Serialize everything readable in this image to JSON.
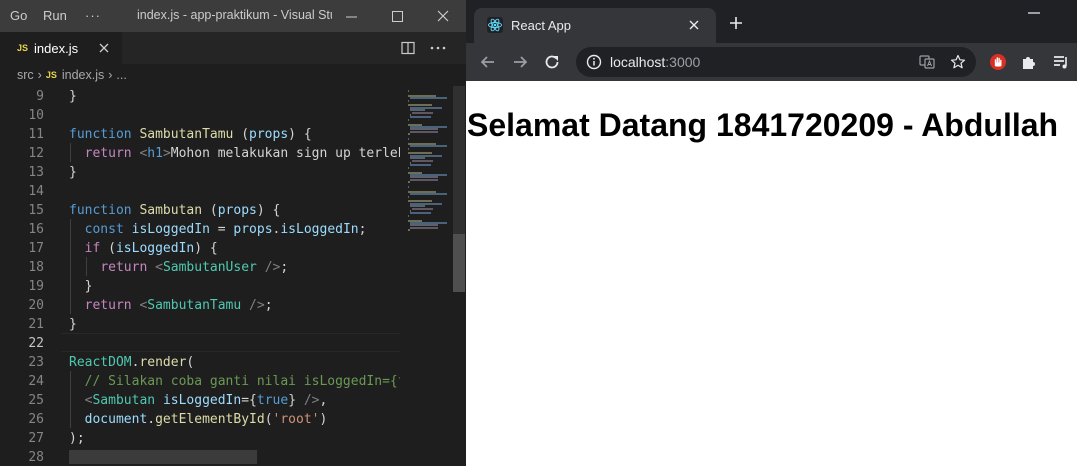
{
  "vscode": {
    "menu": [
      "Go",
      "Run"
    ],
    "more_label": "···",
    "window_title": "index.js - app-praktikum - Visual Studio Code",
    "tab": {
      "badge": "JS",
      "label": "index.js"
    },
    "breadcrumb": {
      "folder": "src",
      "sep1": "›",
      "badge": "JS",
      "file": "index.js",
      "sep2": "›",
      "ellipsis": "..."
    },
    "lines": [
      {
        "n": "9",
        "code": "}"
      },
      {
        "n": "10",
        "code": ""
      },
      {
        "n": "11",
        "code": "function SambutanTamu (props) {"
      },
      {
        "n": "12",
        "code": "  return <h1>Mohon melakukan sign up terleb"
      },
      {
        "n": "13",
        "code": "}"
      },
      {
        "n": "14",
        "code": ""
      },
      {
        "n": "15",
        "code": "function Sambutan (props) {"
      },
      {
        "n": "16",
        "code": "  const isLoggedIn = props.isLoggedIn;"
      },
      {
        "n": "17",
        "code": "  if (isLoggedIn) {"
      },
      {
        "n": "18",
        "code": "    return <SambutanUser />;"
      },
      {
        "n": "19",
        "code": "  }"
      },
      {
        "n": "20",
        "code": "  return <SambutanTamu />;"
      },
      {
        "n": "21",
        "code": "}"
      },
      {
        "n": "22",
        "code": ""
      },
      {
        "n": "23",
        "code": "ReactDOM.render("
      },
      {
        "n": "24",
        "code": "  // Silakan coba ganti nilai isLoggedIn={f"
      },
      {
        "n": "25",
        "code": "  <Sambutan isLoggedIn={true} />,"
      },
      {
        "n": "26",
        "code": "  document.getElementById('root')"
      },
      {
        "n": "27",
        "code": ");"
      },
      {
        "n": "28",
        "code": ""
      }
    ],
    "current_line": "22",
    "colors": {
      "background": "#1e1e1e",
      "titlebar": "#3c3c3c",
      "keyword": "#569cd6",
      "function": "#dcdcaa",
      "variable": "#9cdcfe",
      "string": "#ce9178",
      "comment": "#6a9955",
      "component": "#4ec9b0"
    }
  },
  "chrome": {
    "tab_title": "React App",
    "url_host": "localhost",
    "url_port": ":3000",
    "icons": [
      "react-icon",
      "close-icon",
      "plus-icon",
      "back-arrow-icon",
      "forward-arrow-icon",
      "reload-icon",
      "info-icon",
      "translate-icon",
      "star-icon",
      "hand-extension-icon",
      "puzzle-icon",
      "media-list-icon"
    ],
    "page_heading": "Selamat Datang 1841720209 - Abdullah"
  }
}
